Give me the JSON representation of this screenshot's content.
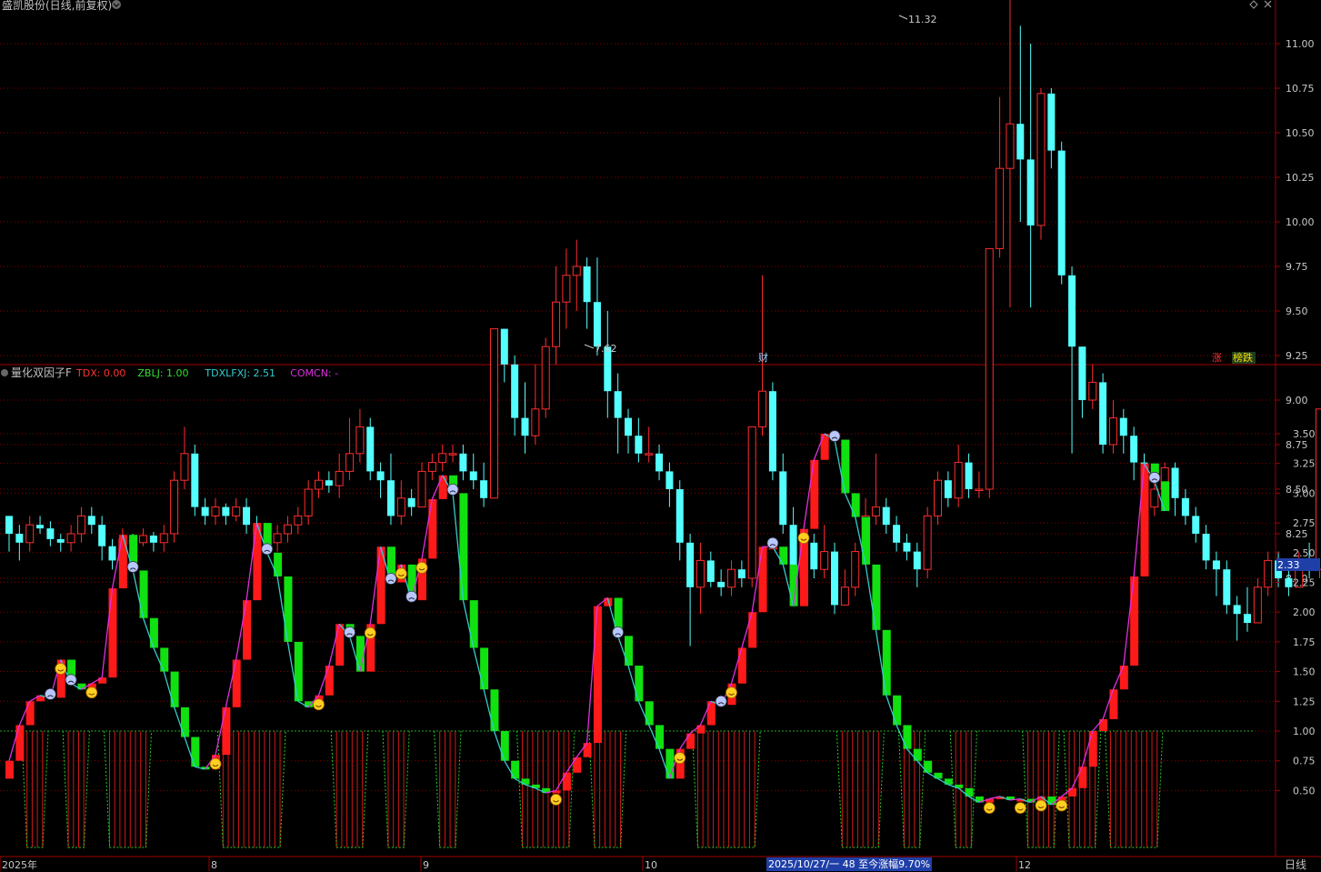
{
  "title": {
    "main": "盛凯股份(日线,前复权)",
    "indicator_name": "量化双因子F",
    "indicator_values": [
      {
        "label": "TDX: 0.00",
        "color": "#ff3333"
      },
      {
        "label": "ZBLJ: 1.00",
        "color": "#33dd33"
      },
      {
        "label": "TDXLFXJ: 2.51",
        "color": "#33cccc"
      },
      {
        "label": "COMCN: -",
        "color": "#dd33dd"
      }
    ]
  },
  "colors": {
    "up": "#ff2d2d",
    "down": "#54ffff",
    "ind_up": "#ff1a1a",
    "ind_down": "#11e011",
    "line_up": "#e030e0",
    "line_down": "#33cccc",
    "grid": "#8b0000",
    "frame": "#a00000"
  },
  "price_axis": [
    "11.00",
    "10.75",
    "10.50",
    "10.25",
    "10.00",
    "9.75",
    "9.50",
    "9.25",
    "9.00",
    "8.75",
    "8.50",
    "8.25",
    "8.00"
  ],
  "indicator_axis": [
    "3.50",
    "3.25",
    "3.00",
    "2.75",
    "2.50",
    "2.25",
    "2.00",
    "1.75",
    "1.50",
    "1.25",
    "1.00",
    "0.75",
    "0.50"
  ],
  "annotations": {
    "high": "11.32",
    "low": "7.62",
    "marker_cai": "财",
    "marker_zhang": "涨",
    "marker_bang": "榜跌",
    "current_value": "2.33",
    "status": "2025/10/27/一 48 至今涨幅9.70%",
    "period_button": "日线"
  },
  "time_labels": [
    "2025年",
    "8",
    "9",
    "10",
    "12"
  ],
  "chart_data": {
    "type": "candlestick",
    "series_name": "盛凯股份(日线,前复权)",
    "ylim": [
      7.5,
      11.5
    ],
    "candles": [
      [
        8.35,
        8.25,
        8.35,
        8.15
      ],
      [
        8.25,
        8.2,
        8.3,
        8.1
      ],
      [
        8.2,
        8.3,
        8.35,
        8.15
      ],
      [
        8.3,
        8.28,
        8.35,
        8.25
      ],
      [
        8.28,
        8.22,
        8.32,
        8.18
      ],
      [
        8.22,
        8.2,
        8.25,
        8.15
      ],
      [
        8.2,
        8.25,
        8.3,
        8.15
      ],
      [
        8.25,
        8.35,
        8.4,
        8.2
      ],
      [
        8.35,
        8.3,
        8.4,
        8.25
      ],
      [
        8.3,
        8.18,
        8.35,
        8.1
      ],
      [
        8.18,
        8.1,
        8.22,
        8.05
      ],
      [
        8.1,
        8.22,
        8.28,
        8.05
      ],
      [
        8.22,
        8.2,
        8.25,
        8.15
      ],
      [
        8.2,
        8.24,
        8.28,
        8.18
      ],
      [
        8.24,
        8.2,
        8.26,
        8.15
      ],
      [
        8.2,
        8.25,
        8.3,
        8.15
      ],
      [
        8.25,
        8.55,
        8.6,
        8.2
      ],
      [
        8.55,
        8.7,
        8.85,
        8.5
      ],
      [
        8.7,
        8.4,
        8.75,
        8.35
      ],
      [
        8.4,
        8.35,
        8.45,
        8.3
      ],
      [
        8.35,
        8.4,
        8.45,
        8.3
      ],
      [
        8.4,
        8.35,
        8.42,
        8.3
      ],
      [
        8.35,
        8.4,
        8.45,
        8.32
      ],
      [
        8.4,
        8.3,
        8.45,
        8.25
      ],
      [
        8.3,
        8.25,
        8.35,
        8.2
      ],
      [
        8.25,
        8.2,
        8.3,
        8.15
      ],
      [
        8.2,
        8.25,
        8.3,
        8.15
      ],
      [
        8.25,
        8.3,
        8.35,
        8.2
      ],
      [
        8.3,
        8.35,
        8.4,
        8.25
      ],
      [
        8.35,
        8.5,
        8.55,
        8.3
      ],
      [
        8.5,
        8.55,
        8.6,
        8.45
      ],
      [
        8.55,
        8.52,
        8.6,
        8.48
      ],
      [
        8.52,
        8.6,
        8.7,
        8.45
      ],
      [
        8.6,
        8.7,
        8.9,
        8.55
      ],
      [
        8.7,
        8.85,
        8.95,
        8.65
      ],
      [
        8.85,
        8.6,
        8.9,
        8.55
      ],
      [
        8.6,
        8.55,
        8.65,
        8.45
      ],
      [
        8.55,
        8.35,
        8.7,
        8.3
      ],
      [
        8.35,
        8.45,
        8.55,
        8.3
      ],
      [
        8.45,
        8.4,
        8.5,
        8.35
      ],
      [
        8.4,
        8.6,
        8.65,
        8.4
      ],
      [
        8.6,
        8.65,
        8.7,
        8.55
      ],
      [
        8.65,
        8.7,
        8.75,
        8.6
      ],
      [
        8.7,
        8.7,
        8.75,
        8.65
      ],
      [
        8.7,
        8.6,
        8.75,
        8.55
      ],
      [
        8.6,
        8.55,
        8.7,
        8.5
      ],
      [
        8.55,
        8.45,
        8.65,
        8.4
      ],
      [
        8.45,
        9.4,
        9.4,
        8.45
      ],
      [
        9.4,
        9.2,
        9.4,
        9.1
      ],
      [
        9.2,
        8.9,
        9.25,
        8.8
      ],
      [
        8.9,
        8.8,
        9.1,
        8.7
      ],
      [
        8.8,
        8.95,
        9.2,
        8.75
      ],
      [
        8.95,
        9.3,
        9.35,
        8.9
      ],
      [
        9.3,
        9.55,
        9.75,
        9.2
      ],
      [
        9.55,
        9.7,
        9.85,
        9.4
      ],
      [
        9.7,
        9.75,
        9.9,
        9.5
      ],
      [
        9.75,
        9.55,
        9.8,
        9.4
      ],
      [
        9.55,
        9.3,
        9.8,
        9.25
      ],
      [
        9.3,
        9.05,
        9.5,
        8.9
      ],
      [
        9.05,
        8.9,
        9.15,
        8.7
      ],
      [
        8.9,
        8.8,
        8.95,
        8.7
      ],
      [
        8.8,
        8.7,
        8.9,
        8.65
      ],
      [
        8.7,
        8.7,
        8.85,
        8.65
      ],
      [
        8.7,
        8.6,
        8.75,
        8.55
      ],
      [
        8.6,
        8.5,
        8.65,
        8.4
      ],
      [
        8.5,
        8.2,
        8.55,
        8.1
      ],
      [
        8.2,
        7.95,
        8.25,
        7.62
      ],
      [
        7.95,
        8.1,
        8.2,
        7.8
      ],
      [
        8.1,
        7.98,
        8.15,
        7.95
      ],
      [
        7.98,
        7.95,
        8.05,
        7.9
      ],
      [
        7.95,
        8.05,
        8.1,
        7.9
      ],
      [
        8.05,
        8.0,
        8.1,
        7.95
      ],
      [
        8.0,
        8.85,
        8.85,
        7.95
      ],
      [
        8.85,
        9.05,
        9.7,
        8.8
      ],
      [
        9.05,
        8.6,
        9.1,
        8.55
      ],
      [
        8.6,
        8.3,
        8.7,
        8.25
      ],
      [
        8.3,
        8.0,
        8.4,
        7.95
      ],
      [
        8.0,
        8.2,
        8.25,
        7.95
      ],
      [
        8.2,
        8.05,
        8.25,
        8.0
      ],
      [
        8.05,
        8.15,
        8.3,
        8.0
      ],
      [
        8.15,
        7.85,
        8.2,
        7.8
      ],
      [
        7.85,
        7.95,
        8.05,
        7.85
      ],
      [
        7.95,
        8.15,
        8.2,
        7.9
      ],
      [
        8.15,
        8.35,
        8.45,
        8.1
      ],
      [
        8.35,
        8.4,
        8.7,
        8.3
      ],
      [
        8.4,
        8.3,
        8.45,
        8.25
      ],
      [
        8.3,
        8.2,
        8.35,
        8.15
      ],
      [
        8.2,
        8.15,
        8.25,
        8.1
      ],
      [
        8.15,
        8.05,
        8.2,
        7.95
      ],
      [
        8.05,
        8.35,
        8.4,
        8.0
      ],
      [
        8.35,
        8.55,
        8.6,
        8.3
      ],
      [
        8.55,
        8.45,
        8.6,
        8.4
      ],
      [
        8.45,
        8.65,
        8.75,
        8.4
      ],
      [
        8.65,
        8.5,
        8.7,
        8.45
      ],
      [
        8.5,
        8.5,
        8.6,
        8.45
      ],
      [
        8.5,
        9.85,
        9.85,
        8.45
      ],
      [
        9.85,
        10.3,
        10.7,
        9.8
      ],
      [
        10.3,
        10.55,
        11.32,
        9.52
      ],
      [
        10.55,
        10.35,
        11.1,
        10.0
      ],
      [
        10.35,
        9.98,
        11.0,
        9.52
      ],
      [
        9.98,
        10.72,
        10.75,
        9.9
      ],
      [
        10.72,
        10.4,
        10.75,
        10.3
      ],
      [
        10.4,
        9.7,
        10.45,
        9.65
      ],
      [
        9.7,
        9.3,
        9.75,
        8.7
      ],
      [
        9.3,
        9.0,
        9.3,
        8.9
      ],
      [
        9.0,
        9.1,
        9.2,
        8.95
      ],
      [
        9.1,
        8.75,
        9.15,
        8.7
      ],
      [
        8.75,
        8.9,
        9.0,
        8.7
      ],
      [
        8.9,
        8.8,
        8.95,
        8.7
      ],
      [
        8.8,
        8.65,
        8.85,
        8.55
      ],
      [
        8.65,
        8.4,
        8.7,
        8.35
      ],
      [
        8.4,
        8.5,
        8.55,
        8.35
      ],
      [
        8.5,
        8.62,
        8.65,
        8.45
      ],
      [
        8.62,
        8.45,
        8.65,
        8.35
      ],
      [
        8.45,
        8.35,
        8.5,
        8.3
      ],
      [
        8.35,
        8.25,
        8.4,
        8.2
      ],
      [
        8.25,
        8.1,
        8.3,
        8.05
      ],
      [
        8.1,
        8.05,
        8.15,
        7.9
      ],
      [
        8.05,
        7.85,
        8.1,
        7.8
      ],
      [
        7.85,
        7.8,
        7.9,
        7.65
      ],
      [
        7.8,
        7.75,
        7.95,
        7.7
      ],
      [
        7.75,
        7.95,
        8.0,
        7.75
      ],
      [
        7.95,
        8.1,
        8.15,
        7.9
      ],
      [
        8.1,
        8.0,
        8.15,
        7.95
      ],
      [
        8.0,
        7.95,
        8.05,
        7.9
      ],
      [
        7.95,
        8.1,
        8.15,
        7.95
      ],
      [
        8.1,
        8.05,
        8.2,
        8.0
      ],
      [
        8.05,
        8.95,
        8.95,
        8.0
      ],
      [
        8.95,
        9.4,
        9.95,
        8.9
      ],
      [
        9.4,
        10.0,
        10.8,
        9.45
      ],
      [
        10.0,
        9.05,
        10.1,
        9.05
      ]
    ],
    "indicator": [
      0.75,
      1.05,
      1.25,
      1.3,
      1.28,
      1.6,
      1.4,
      1.35,
      1.4,
      1.45,
      2.2,
      2.65,
      2.35,
      1.95,
      1.7,
      1.5,
      1.2,
      0.95,
      0.7,
      0.68,
      0.8,
      1.2,
      1.6,
      2.1,
      2.75,
      2.5,
      2.3,
      1.75,
      1.25,
      1.2,
      1.3,
      1.55,
      1.9,
      1.8,
      1.5,
      1.9,
      2.55,
      2.25,
      2.4,
      2.1,
      2.45,
      2.95,
      3.15,
      3.0,
      2.1,
      1.7,
      1.35,
      1.0,
      0.75,
      0.6,
      0.55,
      0.52,
      0.48,
      0.5,
      0.65,
      0.78,
      0.9,
      2.05,
      2.12,
      1.8,
      1.55,
      1.25,
      1.05,
      0.85,
      0.6,
      0.85,
      0.98,
      1.05,
      1.25,
      1.22,
      1.4,
      1.7,
      2.0,
      2.55,
      2.55,
      2.4,
      2.05,
      2.7,
      3.28,
      3.5,
      3.45,
      3.0,
      2.8,
      2.4,
      1.85,
      1.3,
      1.05,
      0.85,
      0.75,
      0.65,
      0.6,
      0.55,
      0.52,
      0.45,
      0.4,
      0.43,
      0.45,
      0.42,
      0.43,
      0.4,
      0.45,
      0.38,
      0.45,
      0.52,
      0.7,
      1.0,
      1.1,
      1.35,
      1.55,
      2.3,
      3.25,
      3.1,
      2.85
    ],
    "signal_zones": [
      [
        2,
        3
      ],
      [
        6,
        7
      ],
      [
        10,
        13
      ],
      [
        21,
        26
      ],
      [
        32,
        34
      ],
      [
        37,
        38
      ],
      [
        42,
        43
      ],
      [
        50,
        54
      ],
      [
        57,
        59
      ],
      [
        67,
        72
      ],
      [
        81,
        84
      ],
      [
        87,
        88
      ],
      [
        92,
        93
      ],
      [
        99,
        101
      ],
      [
        103,
        105
      ],
      [
        107,
        111
      ]
    ]
  }
}
